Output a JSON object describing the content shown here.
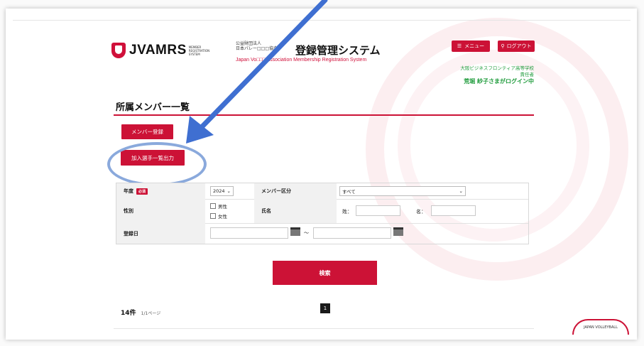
{
  "header": {
    "brand": "JVAMRS",
    "brand_sub": "MEMBER REGISTRATION SYSTEM",
    "assoc_line1": "公益財団法人",
    "assoc_line2": "日本バレー□□□協会",
    "assoc_en": "Japan Vo□□□ Association  Membership Registration System",
    "system_title": "登録管理システム",
    "menu_label": "メニュー",
    "logout_label": "ログアウト",
    "school_name": "大阪ビジネスフロンティア高等学校",
    "role": "責任者",
    "login_user": "荒堀 紗子さまがログイン中"
  },
  "page": {
    "title": "所属メンバー一覧",
    "member_register_button": "メンバー登録",
    "export_button": "加入選手一覧出力"
  },
  "form": {
    "year_label": "年度",
    "required_badge": "必須",
    "year_value": "2024",
    "member_type_label": "メンバー区分",
    "member_type_value": "すべて",
    "gender_label": "性別",
    "gender_male": "男性",
    "gender_female": "女性",
    "name_label": "氏名",
    "surname_label": "姓：",
    "given_label": "名：",
    "reg_date_label": "登録日",
    "range_sep": "～",
    "search_button": "検索"
  },
  "results": {
    "count": "14件",
    "page_info": "1/1ページ",
    "current_page": "1"
  },
  "footer": {
    "jv_logo_text": "JAPAN VOLLEYBALL"
  },
  "colors": {
    "accent": "#cc1236",
    "annotation": "#3f6fd1",
    "login_green": "#1e9b3b"
  }
}
